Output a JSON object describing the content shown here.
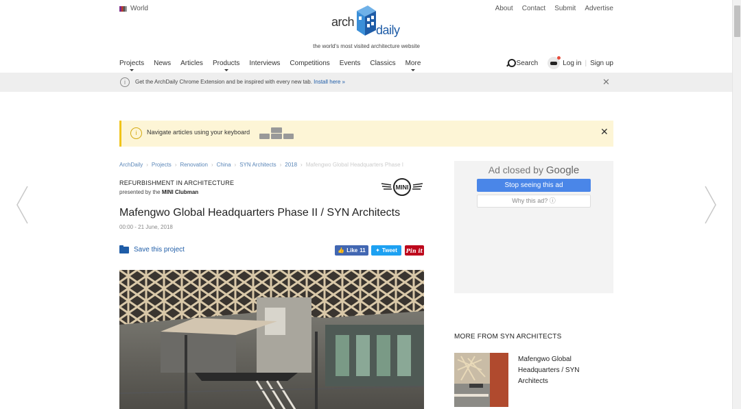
{
  "topbar": {
    "region": "World",
    "links": [
      "About",
      "Contact",
      "Submit",
      "Advertise"
    ]
  },
  "logo": {
    "arch": "arch",
    "daily": "daily",
    "tagline": "the world's most visited architecture website"
  },
  "nav": {
    "items": [
      "Projects",
      "News",
      "Articles",
      "Products",
      "Interviews",
      "Competitions",
      "Events",
      "Classics",
      "More"
    ],
    "search_label": "Search",
    "login_label": "Log in",
    "signup_label": "Sign up"
  },
  "extension_banner": {
    "text": "Get the ArchDaily Chrome Extension and be inspired with every new tab.",
    "link": "Install here »"
  },
  "keyboard_notice": {
    "text": "Navigate articles using your keyboard"
  },
  "breadcrumb": [
    "ArchDaily",
    "Projects",
    "Renovation",
    "China",
    "SYN Architects",
    "2018",
    "Mafengwo Global Headquarters Phase I"
  ],
  "article": {
    "category": "REFURBISHMENT IN ARCHITECTURE",
    "presented_prefix": "presented by the",
    "sponsor": "MINI Clubman",
    "sponsor_logo_text": "MINI",
    "title": "Mafengwo Global Headquarters Phase II / SYN Architects",
    "date": "00:00 - 21 June, 2018",
    "save_label": "Save this project"
  },
  "social": {
    "like_label": "Like",
    "like_count": "11",
    "tweet_label": "Tweet",
    "pin_label": "Pin it"
  },
  "ad": {
    "closed_prefix": "Ad closed by",
    "closed_brand": "Google",
    "stop_label": "Stop seeing this ad",
    "why_label": "Why this ad? ⓘ"
  },
  "more_from": {
    "heading": "MORE FROM SYN ARCHITECTS",
    "item_title": "Mafengwo Global Headquarters / SYN Architects"
  },
  "colors": {
    "accent_blue": "#1e5ca7",
    "notice_bg": "#fdf5d6",
    "notice_border": "#f0c419",
    "google_blue": "#4a86e8"
  }
}
